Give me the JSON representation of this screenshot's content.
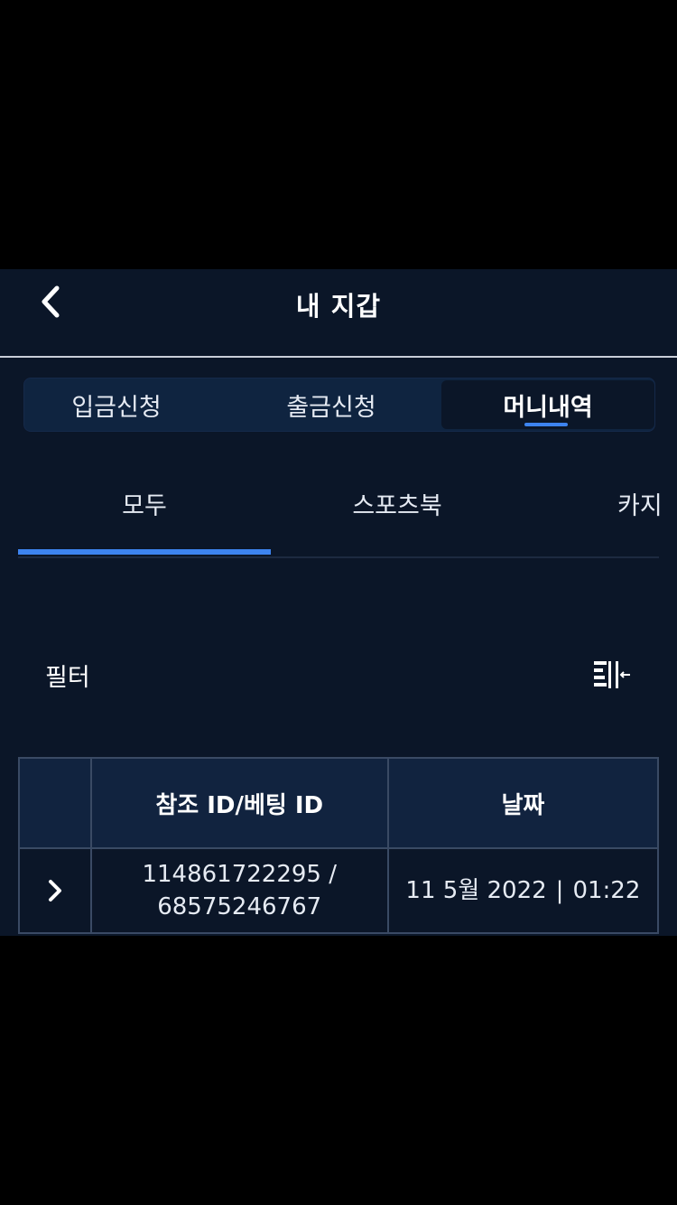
{
  "header": {
    "title": "내 지갑",
    "back_icon": "chevron-left-icon"
  },
  "wallet_tabs": [
    {
      "label": "입금신청",
      "active": false
    },
    {
      "label": "출금신청",
      "active": false
    },
    {
      "label": "머니내역",
      "active": true
    }
  ],
  "sub_tabs": [
    {
      "label": "모두",
      "active": true
    },
    {
      "label": "스포츠북",
      "active": false
    },
    {
      "label": "카지",
      "active": false
    }
  ],
  "filter": {
    "label": "필터",
    "icon": "filter-collapse-icon"
  },
  "table": {
    "headers": [
      "",
      "참조 ID/베팅 ID",
      "날짜"
    ],
    "rows": [
      {
        "ref_id": "114861722295 /",
        "bet_id": "68575246767",
        "date": "11 5월 2022",
        "time": "01:22",
        "separator": "|"
      }
    ]
  },
  "colors": {
    "background": "#0b1628",
    "panel": "#0f2440",
    "accent": "#3d84f0",
    "border": "#3a4a64"
  }
}
